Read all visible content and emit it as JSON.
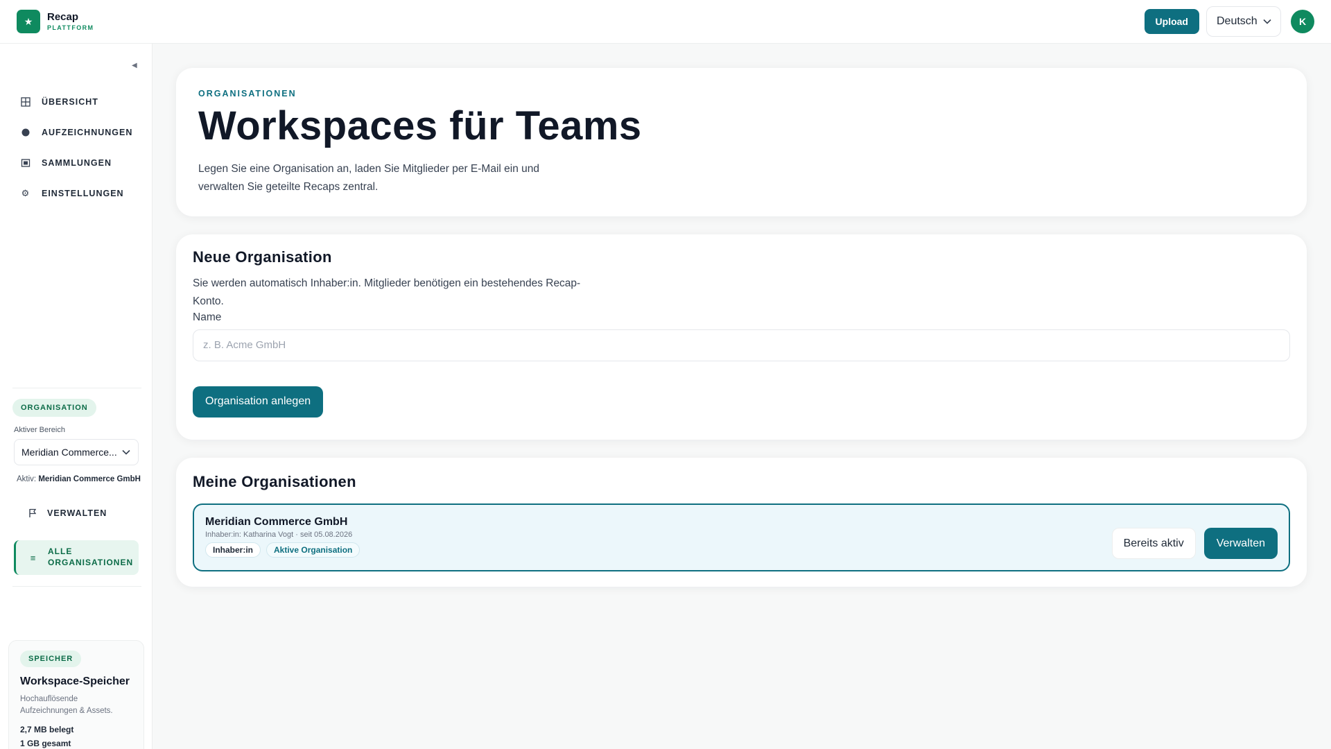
{
  "brand": {
    "name": "Recap",
    "sub": "PLATTFORM",
    "logo_icon": "star-icon"
  },
  "header": {
    "upload_label": "Upload",
    "language": "Deutsch",
    "avatar_initial": "K"
  },
  "sidebar": {
    "items": [
      {
        "label": "ÜBERSICHT",
        "icon": "grid-icon"
      },
      {
        "label": "AUFZEICHNUNGEN",
        "icon": "record-dot-icon"
      },
      {
        "label": "SAMMLUNGEN",
        "icon": "collection-icon"
      },
      {
        "label": "EINSTELLUNGEN",
        "icon": "gear-icon"
      }
    ],
    "org_section_label": "ORGANISATION",
    "active_area_label": "Aktiver Bereich",
    "active_area_value": "Meridian Commerce...",
    "active_prefix": "Aktiv:",
    "active_org_name": "Meridian Commerce GmbH",
    "manage_label": "VERWALTEN",
    "all_orgs_label": "ALLE ORGANISATIONEN",
    "storage": {
      "badge": "SPEICHER",
      "title": "Workspace-Speicher",
      "description": "Hochauflösende Aufzeichnungen & Assets.",
      "used": "2,7 MB belegt",
      "total": "1 GB gesamt",
      "used_fraction": 0.0027
    }
  },
  "hero": {
    "eyebrow": "ORGANISATIONEN",
    "title": "Workspaces für Teams",
    "description": "Legen Sie eine Organisation an, laden Sie Mitglieder per E-Mail ein und verwalten Sie geteilte Recaps zentral."
  },
  "new_org": {
    "title": "Neue Organisation",
    "description": "Sie werden automatisch Inhaber:in. Mitglieder benötigen ein bestehendes Recap-Konto.",
    "name_label": "Name",
    "name_placeholder": "z. B. Acme GmbH",
    "name_value": "",
    "create_label": "Organisation anlegen"
  },
  "my_orgs": {
    "title": "Meine Organisationen",
    "items": [
      {
        "name": "Meridian Commerce GmbH",
        "meta": "Inhaber:in: Katharina Vogt · seit 05.08.2026",
        "tags": [
          "Inhaber:in",
          "Aktive Organisation"
        ],
        "status_label": "Bereits aktiv",
        "manage_label": "Verwalten"
      }
    ]
  },
  "colors": {
    "accent": "#0e6f80",
    "brand": "#0f8a5f",
    "tint": "#ecf7fb"
  }
}
